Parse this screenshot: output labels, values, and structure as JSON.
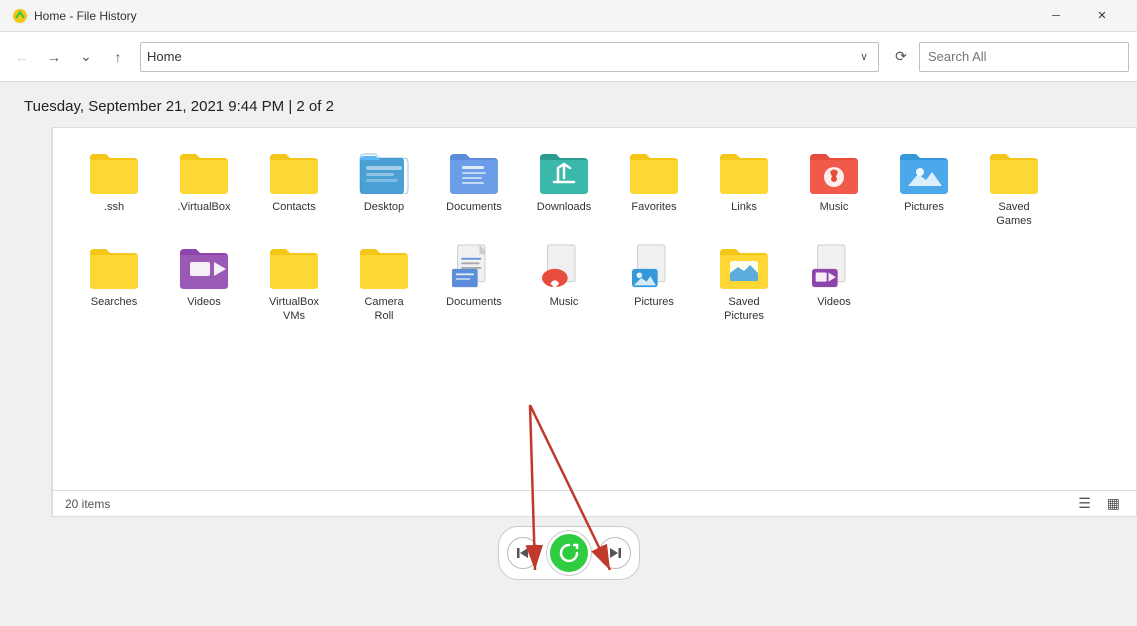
{
  "titleBar": {
    "title": "Home - File History",
    "minimizeLabel": "─",
    "closeLabel": "✕"
  },
  "navBar": {
    "backLabel": "←",
    "forwardLabel": "→",
    "recentLabel": "⌄",
    "upLabel": "↑",
    "addressValue": "Home",
    "addressArrow": "∨",
    "refreshLabel": "⟳",
    "searchPlaceholder": "Search All"
  },
  "dateHeader": "Tuesday, September 21, 2021 9:44 PM  |  2 of 2",
  "statusBar": {
    "itemCount": "20 items",
    "viewList": "☰",
    "viewGrid": "▦"
  },
  "items": [
    {
      "id": "ssh",
      "label": ".ssh",
      "type": "folder-plain"
    },
    {
      "id": "virtualbox",
      "label": ".VirtualBox",
      "type": "folder-plain"
    },
    {
      "id": "contacts",
      "label": "Contacts",
      "type": "folder-plain"
    },
    {
      "id": "desktop",
      "label": "Desktop",
      "type": "folder-blue"
    },
    {
      "id": "documents",
      "label": "Documents",
      "type": "folder-doc"
    },
    {
      "id": "downloads",
      "label": "Downloads",
      "type": "folder-teal"
    },
    {
      "id": "favorites",
      "label": "Favorites",
      "type": "folder-plain"
    },
    {
      "id": "links",
      "label": "Links",
      "type": "folder-plain"
    },
    {
      "id": "music",
      "label": "Music",
      "type": "folder-music"
    },
    {
      "id": "pictures",
      "label": "Pictures",
      "type": "folder-pics"
    },
    {
      "id": "saved-games",
      "label": "Saved\nGames",
      "type": "folder-plain"
    },
    {
      "id": "searches",
      "label": "Searches",
      "type": "folder-plain"
    },
    {
      "id": "videos",
      "label": "Videos",
      "type": "folder-video"
    },
    {
      "id": "vbox-vms",
      "label": "VirtualBox\nVMs",
      "type": "folder-plain"
    },
    {
      "id": "camera-roll",
      "label": "Camera\nRoll",
      "type": "folder-plain"
    },
    {
      "id": "documents2",
      "label": "Documents",
      "type": "folder-doc2"
    },
    {
      "id": "music2",
      "label": "Music",
      "type": "folder-music2"
    },
    {
      "id": "pictures2",
      "label": "Pictures",
      "type": "folder-pics2"
    },
    {
      "id": "saved-pics",
      "label": "Saved\nPictures",
      "type": "folder-savedpics"
    },
    {
      "id": "videos2",
      "label": "Videos",
      "type": "folder-video2"
    }
  ],
  "bottomNav": {
    "prevLabel": "⏮",
    "nextLabel": "⏭",
    "refreshLabel": "↺"
  }
}
